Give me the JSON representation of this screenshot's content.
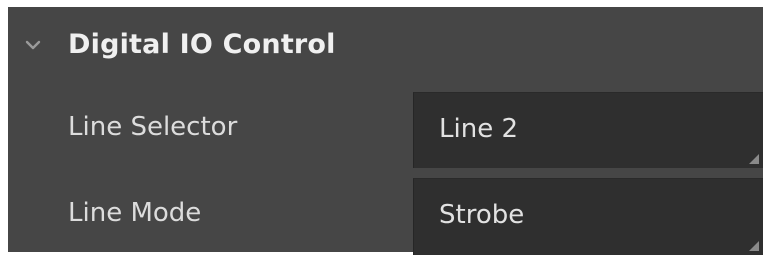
{
  "section": {
    "title": "Digital IO Control",
    "expanded": true,
    "toggle_icon": "chevron-down-icon"
  },
  "rows": [
    {
      "label": "Line Selector",
      "value": "Line 2",
      "icon": "dropdown-grip-icon"
    },
    {
      "label": "Line Mode",
      "value": "Strobe",
      "icon": "dropdown-grip-icon"
    }
  ],
  "colors": {
    "panel_bg": "#464646",
    "field_bg": "#2f2f2f",
    "text": "#e3e3e3"
  }
}
